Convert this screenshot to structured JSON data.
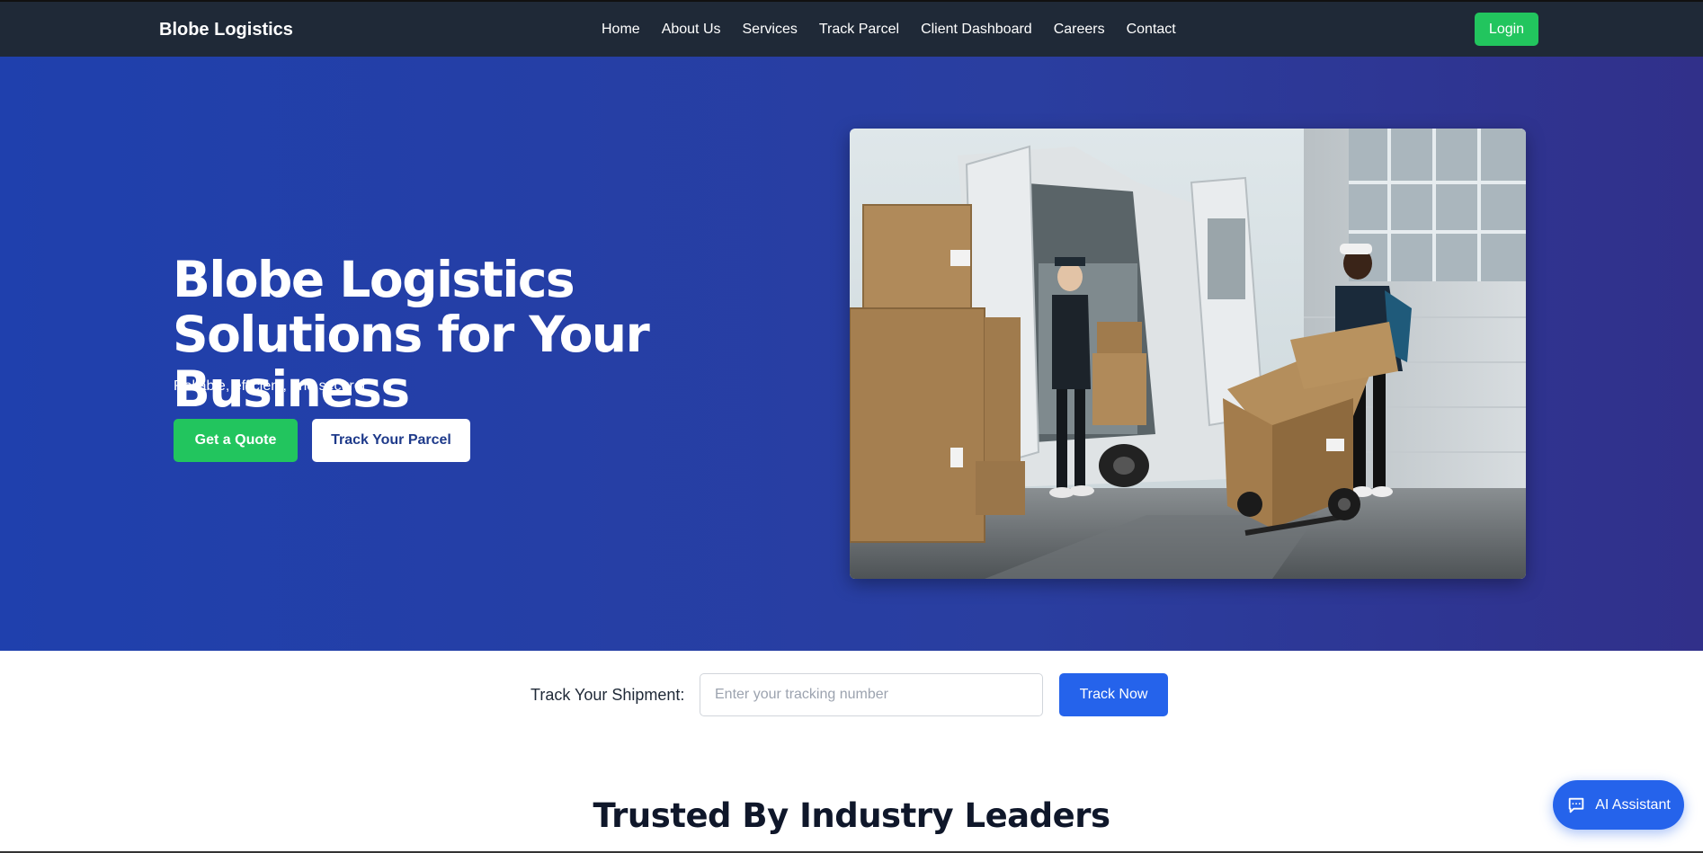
{
  "nav": {
    "brand": "Blobe Logistics",
    "links": [
      "Home",
      "About Us",
      "Services",
      "Track Parcel",
      "Client Dashboard",
      "Careers",
      "Contact"
    ],
    "login_label": "Login"
  },
  "hero": {
    "title": "Blobe Logistics Solutions for Your Business",
    "subtitle": "Reliable, efficient, and secure",
    "quote_label": "Get a Quote",
    "track_label": "Track Your Parcel",
    "image_subject": "delivery workers loading boxes into a van"
  },
  "tracking": {
    "label": "Track Your Shipment:",
    "placeholder": "Enter your tracking number",
    "button_label": "Track Now"
  },
  "trusted": {
    "title": "Trusted By Industry Leaders"
  },
  "assistant": {
    "label": "AI Assistant",
    "icon": "chat-icon"
  },
  "colors": {
    "navbar_bg": "#1f2937",
    "hero_gradient_start": "#1f40ad",
    "hero_gradient_end": "#31308a",
    "accent_green": "#22c55e",
    "accent_blue": "#2563eb"
  }
}
